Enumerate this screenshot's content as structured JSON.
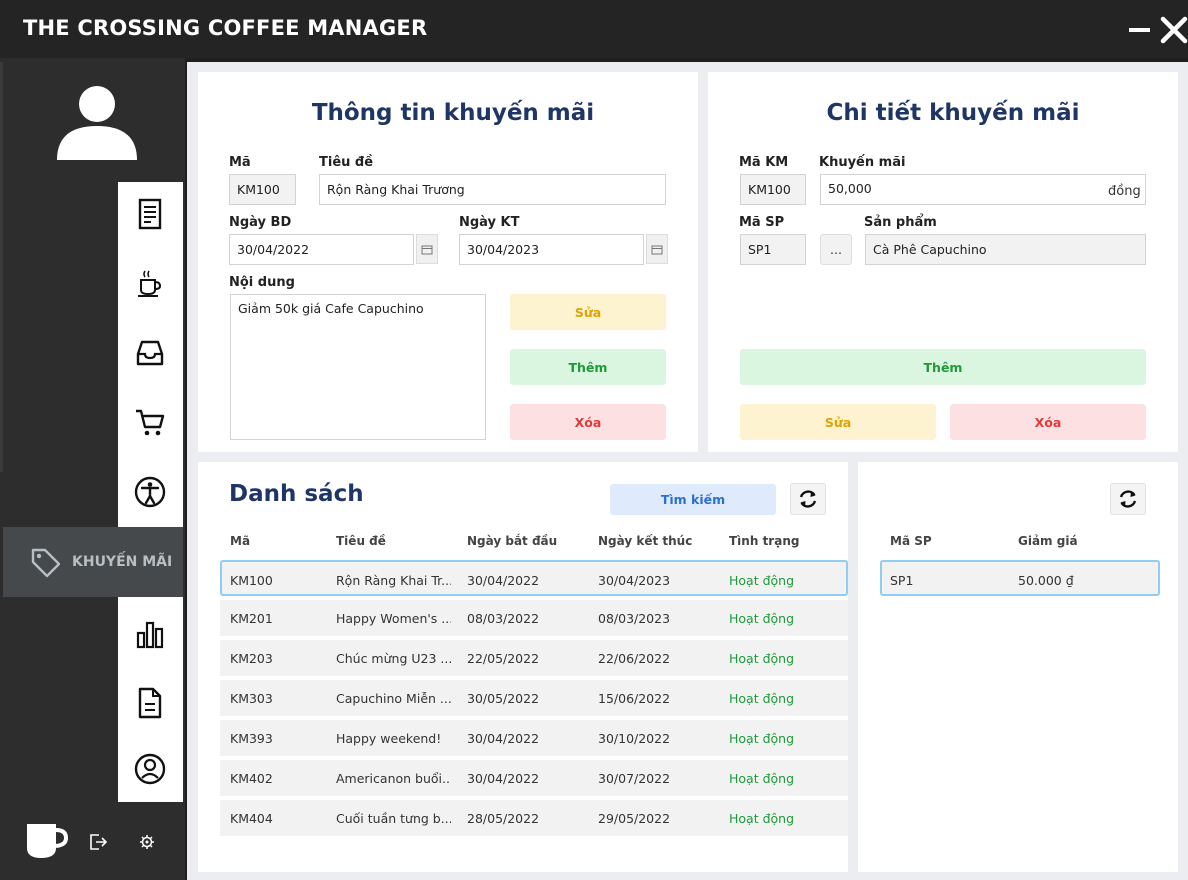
{
  "app": {
    "title": "THE CROSSING COFFEE MANAGER"
  },
  "sidebar": {
    "active_label": "KHUYẾN MÃI",
    "nav_icons": [
      "receipt-icon",
      "coffee-cup-icon",
      "inbox-icon",
      "cart-icon",
      "accessibility-icon",
      "tag-icon",
      "bar-chart-icon",
      "document-icon",
      "user-circle-icon"
    ]
  },
  "promo_info": {
    "title": "Thông tin khuyến mãi",
    "code_label": "Mã",
    "code_value": "KM100",
    "subject_label": "Tiêu đề",
    "subject_value": "Rộn Ràng Khai Trương",
    "start_label": "Ngày BD",
    "start_value": "30/04/2022",
    "end_label": "Ngày KT",
    "end_value": "30/04/2023",
    "content_label": "Nội dung",
    "content_value": "Giảm 50k giá Cafe Capuchino",
    "edit_btn": "Sửa",
    "add_btn": "Thêm",
    "delete_btn": "Xóa"
  },
  "promo_detail": {
    "title": "Chi tiết khuyến mãi",
    "km_label": "Mã KM",
    "km_value": "KM100",
    "discount_label": "Khuyến mãi",
    "discount_value": "50,000",
    "discount_unit": "đồng",
    "sp_label": "Mã SP",
    "sp_value": "SP1",
    "pick_btn": "...",
    "product_label": "Sản phẩm",
    "product_value": "Cà Phê Capuchino",
    "add_btn": "Thêm",
    "edit_btn": "Sửa",
    "delete_btn": "Xóa"
  },
  "list": {
    "title": "Danh sách",
    "search_btn": "Tìm kiếm",
    "headers": [
      "Mã",
      "Tiêu đề",
      "Ngày bắt đầu",
      "Ngày kết thúc",
      "Tình trạng"
    ],
    "rows": [
      [
        "KM100",
        "Rộn Ràng Khai Tr...",
        "30/04/2022",
        "30/04/2023",
        "Hoạt động"
      ],
      [
        "KM201",
        "Happy Women's ...",
        "08/03/2022",
        "08/03/2023",
        "Hoạt động"
      ],
      [
        "KM203",
        "Chúc mừng U23 ...",
        "22/05/2022",
        "22/06/2022",
        "Hoạt động"
      ],
      [
        "KM303",
        "Capuchino Miễn ...",
        "30/05/2022",
        "15/06/2022",
        "Hoạt động"
      ],
      [
        "KM393",
        "Happy weekend!",
        "30/04/2022",
        "30/10/2022",
        "Hoạt động"
      ],
      [
        "KM402",
        "Americanon buổi...",
        "30/04/2022",
        "30/07/2022",
        "Hoạt động"
      ],
      [
        "KM404",
        "Cuối tuần tưng b...",
        "28/05/2022",
        "29/05/2022",
        "Hoạt động"
      ]
    ]
  },
  "detail_list": {
    "headers": [
      "Mã SP",
      "Giảm giá"
    ],
    "rows": [
      [
        "SP1",
        "50.000 ₫"
      ]
    ]
  }
}
